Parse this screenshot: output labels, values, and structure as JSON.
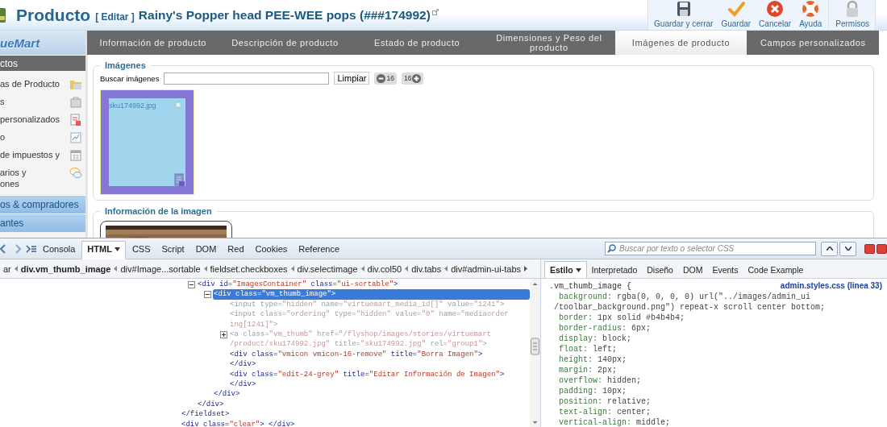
{
  "header": {
    "title": "Producto",
    "action": "[ Editar ]",
    "product": "Rainy's Popper head PEE-WEE pops (###174992)"
  },
  "toolbar": [
    {
      "label": "Guardar y cerrar",
      "kind": "save"
    },
    {
      "label": "Guardar",
      "kind": "apply"
    },
    {
      "label": "Cancelar",
      "kind": "cancel"
    },
    {
      "label": "Ayuda",
      "kind": "help"
    },
    {
      "label": "Permisos",
      "kind": "lock"
    }
  ],
  "logo": "ueMart",
  "sidebar": [
    {
      "label": "ctos",
      "expanded": true,
      "items": [
        "as de Producto",
        "s",
        " personalizados",
        "o",
        "de impuestos y",
        "arios y\nones"
      ]
    },
    {
      "label": "os & compradores",
      "expanded": false
    },
    {
      "label": "antes",
      "expanded": false
    }
  ],
  "tabs": [
    {
      "label": "Información de producto",
      "selected": false
    },
    {
      "label": "Descripción de producto",
      "selected": false
    },
    {
      "label": "Estado de producto",
      "selected": false
    },
    {
      "label": "Dimensiones y Peso del producto",
      "selected": false
    },
    {
      "label": "Imágenes de producto",
      "selected": true
    },
    {
      "label": "Campos personalizados",
      "selected": false
    }
  ],
  "images": {
    "legend": "Imágenes",
    "search_label": "Buscar imágenes",
    "clear_button": "Limpiar",
    "zoom": [
      {
        "kind": "decrease",
        "label": "16"
      },
      {
        "kind": "increase",
        "label": "16"
      }
    ],
    "thumbnails": [
      {
        "filename": "sku174992.jpg"
      }
    ]
  },
  "image_info": {
    "legend": "Información de la imagen"
  },
  "devtools": {
    "panels": [
      {
        "label": "Consola",
        "selected": false,
        "menu": false
      },
      {
        "label": "HTML",
        "selected": true,
        "menu": true
      },
      {
        "label": "CSS",
        "selected": false,
        "menu": false
      },
      {
        "label": "Script",
        "selected": false,
        "menu": false
      },
      {
        "label": "DOM",
        "selected": false,
        "menu": false
      },
      {
        "label": "Red",
        "selected": false,
        "menu": false
      },
      {
        "label": "Cookies",
        "selected": false,
        "menu": false
      },
      {
        "label": "Reference",
        "selected": false,
        "menu": false
      }
    ],
    "search": {
      "placeholder": "Buscar por texto o selector CSS"
    },
    "breadcrumbs": [
      {
        "label": "ar",
        "selected": false
      },
      {
        "label": "div.vm_thumb_image",
        "selected": true
      },
      {
        "label": "div#Image...sortable",
        "selected": false
      },
      {
        "label": "fieldset.checkboxes",
        "selected": false
      },
      {
        "label": "div.selectimage",
        "selected": false
      },
      {
        "label": "div.col50",
        "selected": false
      },
      {
        "label": "div.tabs",
        "selected": false
      },
      {
        "label": "div#admin-ui-tabs",
        "selected": false
      }
    ],
    "side_tabs": [
      {
        "label": "Estilo",
        "selected": true,
        "menu": true
      },
      {
        "label": "Interpretado",
        "selected": false,
        "menu": false
      },
      {
        "label": "Diseño",
        "selected": false,
        "menu": false
      },
      {
        "label": "DOM",
        "selected": false,
        "menu": false
      },
      {
        "label": "Events",
        "selected": false,
        "menu": false
      },
      {
        "label": "Code Example",
        "selected": false,
        "menu": false
      }
    ],
    "html_tree": [
      {
        "children": [
          {
            "lines": [
              "<div id=\"ImagesContainer\" class=\"ui-sortable\">"
            ],
            "expanded": true,
            "selected": false,
            "dimmed": false,
            "close": "</div>",
            "children": [
              {
                "lines": [
                  "<div class=\"vm_thumb_image\">"
                ],
                "expanded": true,
                "selected": true,
                "close": "</div>",
                "children": [
                  {
                    "lines": [
                      "<input type=\"hidden\" name=\"virtuemart_media_id[]\" value=\"1241\">"
                    ],
                    "selected": false,
                    "dimmed": true
                  },
                  {
                    "lines": [
                      "<input class=\"ordering\" type=\"hidden\" value=\"0\" name=\"mediaorder",
                      "ing[1241]\">"
                    ],
                    "selected": false,
                    "dimmed": true
                  },
                  {
                    "lines": [
                      "<a class=\"vm_thumb\" href=\"/flyshop/images/stories/virtuemart",
                      "/product/sku174992.jpg\" title=\"sku174992.jpg\" rel=\"group1\">"
                    ],
                    "expanded": false,
                    "selected": false,
                    "dimmed": true
                  },
                  {
                    "lines": [
                      "<div class=\"vmicon vmicon-16-remove\" title=\"Borra Imagen\">",
                      "</div>"
                    ],
                    "selected": false,
                    "dimmed": false
                  },
                  {
                    "lines": [
                      "<div class=\"edit-24-grey\" title=\"Editar Información de Imagen\">",
                      "</div>"
                    ],
                    "selected": false,
                    "dimmed": false
                  }
                ]
              }
            ]
          }
        ],
        "close": "</fieldset>"
      },
      {
        "lines": [
          "<div class=\"clear\"> </div>"
        ],
        "selected": false,
        "dimmed": false
      }
    ],
    "css_rule": {
      "selector": ".vm_thumb_image {",
      "source": "admin.styles.css (linea 33)",
      "properties": [
        {
          "name": "background:",
          "value": [
            "rgba(0, 0, 0, 0) url(\"../images/admin_ui",
            "/toolbar_background.png\") repeat-x scroll center bottom;"
          ]
        },
        {
          "name": "border:",
          "value": [
            "1px solid #b4b4b4;"
          ]
        },
        {
          "name": "border-radius:",
          "value": [
            "6px;"
          ]
        },
        {
          "name": "display:",
          "value": [
            "block;"
          ]
        },
        {
          "name": "float:",
          "value": [
            "left;"
          ]
        },
        {
          "name": "height:",
          "value": [
            "140px;"
          ]
        },
        {
          "name": "margin:",
          "value": [
            "2px;"
          ]
        },
        {
          "name": "overflow:",
          "value": [
            "hidden;"
          ]
        },
        {
          "name": "padding:",
          "value": [
            "10px;"
          ]
        },
        {
          "name": "position:",
          "value": [
            "relative;"
          ]
        },
        {
          "name": "text-align:",
          "value": [
            "center;"
          ]
        },
        {
          "name": "vertical-align:",
          "value": [
            "middle;"
          ]
        }
      ]
    }
  }
}
